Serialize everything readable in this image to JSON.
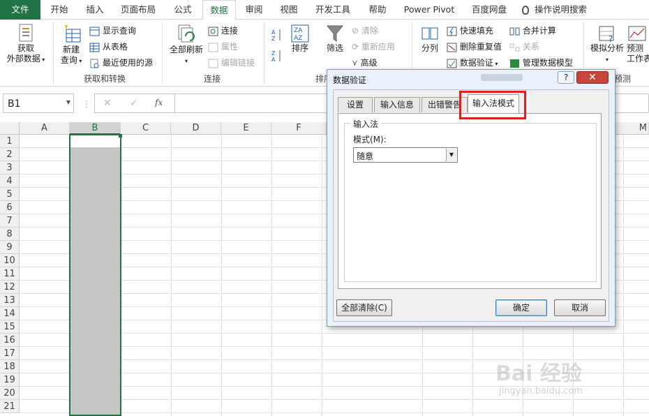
{
  "tabs": [
    "文件",
    "开始",
    "插入",
    "页面布局",
    "公式",
    "数据",
    "审阅",
    "视图",
    "开发工具",
    "帮助",
    "Power Pivot",
    "百度网盘",
    "操作说明搜索"
  ],
  "ribbon": {
    "get_external": [
      "获取",
      "外部数据"
    ],
    "new_query": [
      "新建",
      "查询"
    ],
    "show_query": "显示查询",
    "from_table": "从表格",
    "recent_sources": "最近使用的源",
    "group_get_transform": "获取和转换",
    "refresh_all": "全部刷新",
    "connections": "连接",
    "properties": "属性",
    "edit_links": "编辑链接",
    "group_connections": "连接",
    "sort": "排序",
    "filter": "筛选",
    "clear": "清除",
    "reapply": "重新应用",
    "advanced": "高级",
    "group_sort_filter": "排序",
    "text_to_columns": "分列",
    "flash_fill": "快速填充",
    "remove_duplicates": "删除重复值",
    "data_validation": "数据验证",
    "consolidate": "合并计算",
    "relationships": "关系",
    "manage_model": "管理数据模型",
    "what_if": "模拟分析",
    "forecast": [
      "预测",
      "工作表"
    ],
    "group_forecast": "预测"
  },
  "formula_bar": {
    "name_box": "B1",
    "fx": "fx"
  },
  "columns": [
    "A",
    "B",
    "C",
    "D",
    "E",
    "F"
  ],
  "col_M": "M",
  "rows": [
    "1",
    "2",
    "3",
    "4",
    "5",
    "6",
    "7",
    "8",
    "9",
    "10",
    "11",
    "12",
    "13",
    "14",
    "15",
    "16",
    "17",
    "18",
    "19",
    "20",
    "21"
  ],
  "dialog": {
    "title": "数据验证",
    "help": "?",
    "close": "✕",
    "tabs": [
      "设置",
      "输入信息",
      "出错警告",
      "输入法模式"
    ],
    "group_label": "输入法",
    "mode_label": "模式(M):",
    "mode_value": "随意",
    "clear_all": "全部清除(C)",
    "ok": "确定",
    "cancel": "取消"
  },
  "watermark": "Bai 经验",
  "watermark_url": "jingyan.baidu.com"
}
